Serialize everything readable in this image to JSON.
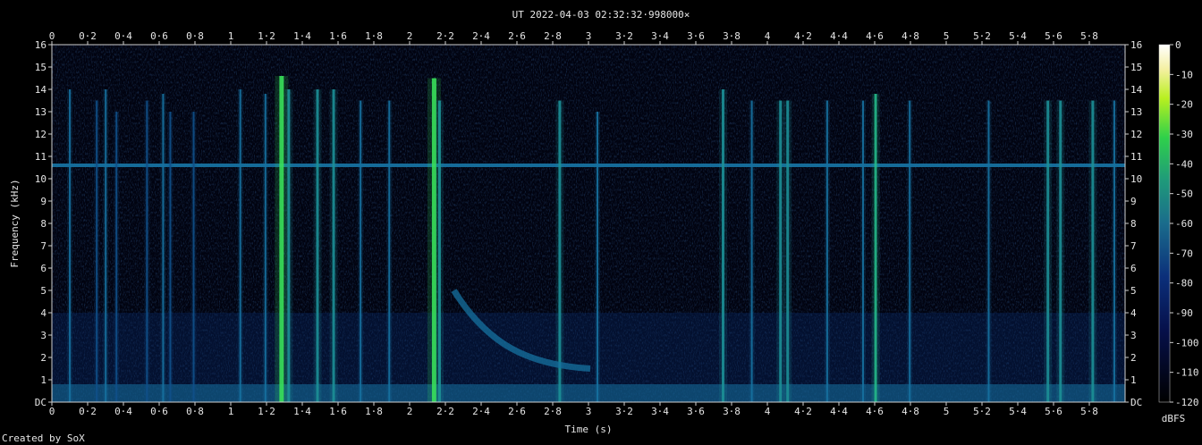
{
  "chart_data": {
    "type": "heatmap",
    "title": "UT 2022-04-03 02:32:32·998000×",
    "xlabel": "Time (s)",
    "ylabel": "Frequency (kHz)",
    "xlim": [
      0,
      5.98
    ],
    "ylim": [
      0,
      16
    ],
    "x_ticks": [
      "0",
      "0·2",
      "0·4",
      "0·6",
      "0·8",
      "1",
      "1·2",
      "1·4",
      "1·6",
      "1·8",
      "2",
      "2·2",
      "2·4",
      "2·6",
      "2·8",
      "3",
      "3·2",
      "3·4",
      "3·6",
      "3·8",
      "4",
      "4·2",
      "4·4",
      "4·6",
      "4·8",
      "5",
      "5·2",
      "5·4",
      "5·6",
      "5·8"
    ],
    "y_ticks": [
      "DC",
      "1",
      "2",
      "3",
      "4",
      "5",
      "6",
      "7",
      "8",
      "9",
      "10",
      "11",
      "12",
      "13",
      "14",
      "15",
      "16"
    ],
    "colorbar": {
      "label": "dBFS",
      "ticks": [
        "0",
        "-10",
        "-20",
        "-30",
        "-40",
        "-50",
        "-60",
        "-70",
        "-80",
        "-90",
        "-100",
        "-110",
        "-120"
      ],
      "range": [
        -120,
        0
      ]
    },
    "credit": "Created by SoX",
    "colors": {
      "background": "#000000",
      "noise_floor": "#031a4a",
      "weak": "#0f4f8a",
      "medium": "#1e8f8a",
      "strong": "#2fd05a",
      "frame": "#cfcfcf"
    },
    "features": {
      "carrier_line_khz": 10.6,
      "carrier_level_dbfs": -85,
      "impulses": [
        {
          "t": 0.1,
          "f_top": 14.0,
          "level": -88
        },
        {
          "t": 0.25,
          "f_top": 13.5,
          "level": -92
        },
        {
          "t": 0.3,
          "f_top": 14.0,
          "level": -88
        },
        {
          "t": 0.36,
          "f_top": 13.0,
          "level": -94
        },
        {
          "t": 0.53,
          "f_top": 13.5,
          "level": -90
        },
        {
          "t": 0.62,
          "f_top": 13.8,
          "level": -86
        },
        {
          "t": 0.66,
          "f_top": 13.0,
          "level": -95
        },
        {
          "t": 0.79,
          "f_top": 13.0,
          "level": -95
        },
        {
          "t": 1.05,
          "f_top": 14.0,
          "level": -88
        },
        {
          "t": 1.19,
          "f_top": 13.8,
          "level": -86
        },
        {
          "t": 1.28,
          "f_top": 14.6,
          "level": -60
        },
        {
          "t": 1.32,
          "f_top": 14.0,
          "level": -80
        },
        {
          "t": 1.48,
          "f_top": 14.0,
          "level": -82
        },
        {
          "t": 1.57,
          "f_top": 14.0,
          "level": -80
        },
        {
          "t": 1.72,
          "f_top": 13.5,
          "level": -88
        },
        {
          "t": 1.88,
          "f_top": 13.5,
          "level": -88
        },
        {
          "t": 2.13,
          "f_top": 14.5,
          "level": -62
        },
        {
          "t": 2.16,
          "f_top": 13.5,
          "level": -78
        },
        {
          "t": 2.83,
          "f_top": 13.5,
          "level": -82
        },
        {
          "t": 3.04,
          "f_top": 13.0,
          "level": -88
        },
        {
          "t": 3.74,
          "f_top": 14.0,
          "level": -78
        },
        {
          "t": 3.9,
          "f_top": 13.5,
          "level": -85
        },
        {
          "t": 4.06,
          "f_top": 13.5,
          "level": -76
        },
        {
          "t": 4.1,
          "f_top": 13.5,
          "level": -78
        },
        {
          "t": 4.32,
          "f_top": 13.5,
          "level": -86
        },
        {
          "t": 4.52,
          "f_top": 13.5,
          "level": -84
        },
        {
          "t": 4.59,
          "f_top": 13.8,
          "level": -74
        },
        {
          "t": 4.78,
          "f_top": 13.5,
          "level": -84
        },
        {
          "t": 5.22,
          "f_top": 13.5,
          "level": -86
        },
        {
          "t": 5.55,
          "f_top": 13.5,
          "level": -80
        },
        {
          "t": 5.62,
          "f_top": 13.5,
          "level": -82
        },
        {
          "t": 5.8,
          "f_top": 13.5,
          "level": -78
        },
        {
          "t": 5.92,
          "f_top": 13.5,
          "level": -84
        }
      ],
      "whistler": {
        "t_start": 2.24,
        "f_start_khz": 5.0,
        "t_end": 3.0,
        "f_end_khz": 1.5,
        "level": -88
      },
      "low_band_khz": [
        0.0,
        0.8
      ],
      "low_band_level": -84
    }
  }
}
